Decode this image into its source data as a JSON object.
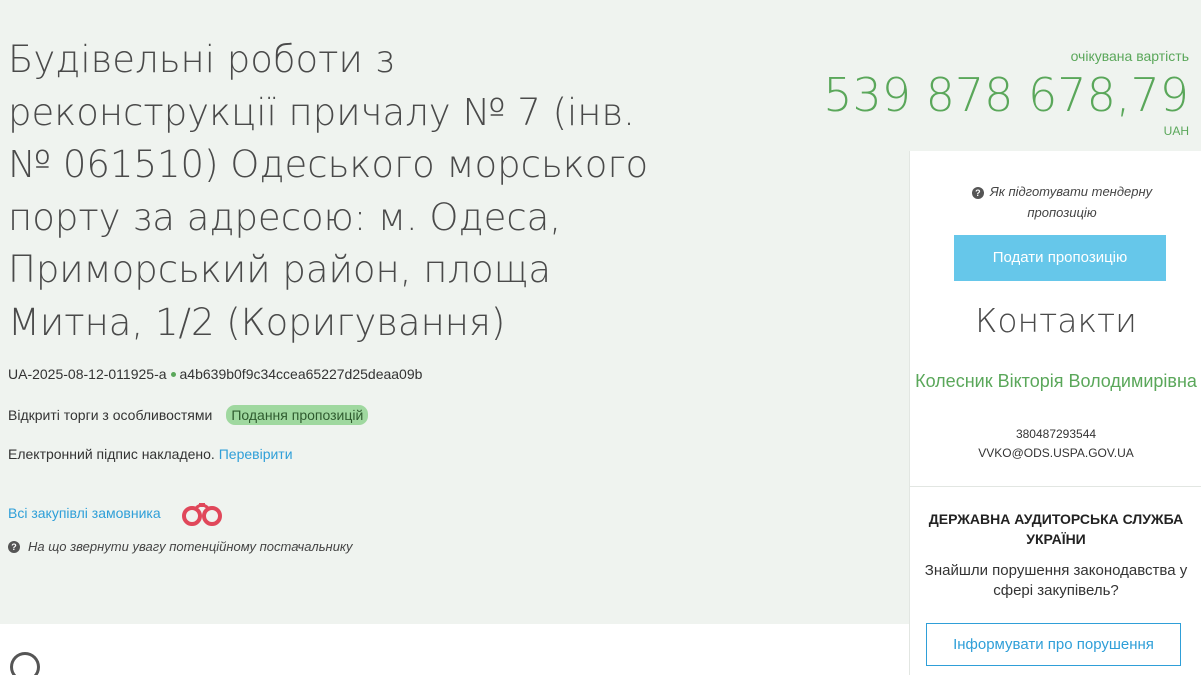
{
  "tender": {
    "title": "Будівельні роботи з реконструкції причалу № 7 (інв. № 061510) Одеського морського порту за адресою: м. Одеса, Приморський район, площа Митна, 1/2 (Коригування)",
    "tender_id": "UA-2025-08-12-011925-a",
    "hash": "a4b639b0f9c34ccea65227d25deaa09b",
    "procedure_type": "Відкриті торги з особливостями",
    "status": "Подання пропозицій",
    "signature_text": "Електронний підпис накладено.",
    "verify_link": "Перевірити",
    "all_purchases_link": "Всі закупівлі замовника",
    "supplier_hint": "На що звернути увагу потенційному постачальнику"
  },
  "price": {
    "label": "очікувана вартість",
    "amount": "539 878 678,79",
    "currency": "UAH"
  },
  "sidebar": {
    "howto": "Як підготувати тендерну пропозицію",
    "submit_button": "Подати пропозицію",
    "contacts_title": "Контакти",
    "contact_name": "Колесник Вікторія Володимирівна",
    "contact_phone": "380487293544",
    "contact_email": "VVKO@ODS.USPA.GOV.UA"
  },
  "audit": {
    "title": "ДЕРЖАВНА АУДИТОРСЬКА СЛУЖБА УКРАЇНИ",
    "text": "Знайшли порушення законодавства у сфері закупівель?",
    "report_button": "Інформувати про порушення"
  },
  "colors": {
    "accent_green": "#5aa75a",
    "link_blue": "#2f9fd8",
    "button_blue": "#66c7ea",
    "badge_green": "#9fd89f",
    "binoculars": "#e0475a"
  },
  "icons": {
    "question": "question-circle-icon",
    "binoculars": "binoculars-icon"
  }
}
